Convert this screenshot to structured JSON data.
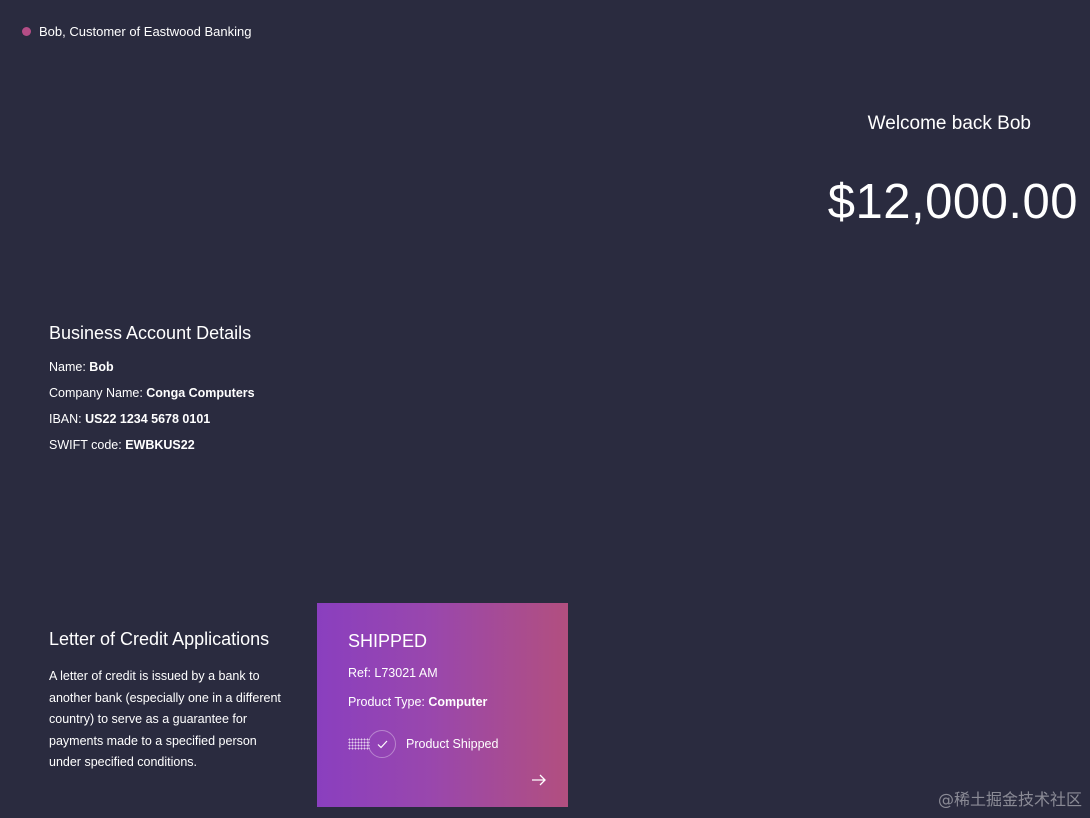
{
  "header": {
    "user_label": "Bob, Customer of Eastwood Banking"
  },
  "summary": {
    "welcome": "Welcome back Bob",
    "balance": "$12,000.00"
  },
  "account": {
    "title": "Business Account Details",
    "name_label": "Name: ",
    "name_value": "Bob",
    "company_label": "Company Name: ",
    "company_value": "Conga Computers",
    "iban_label": "IBAN: ",
    "iban_value": "US22 1234 5678 0101",
    "swift_label": "SWIFT code: ",
    "swift_value": "EWBKUS22"
  },
  "letter_of_credit": {
    "title": "Letter of Credit Applications",
    "description": "A letter of credit is issued by a bank to another bank (especially one in a different country) to serve as a guarantee for payments made to a specified person under specified conditions."
  },
  "card": {
    "status": "SHIPPED",
    "ref_label": "Ref: ",
    "ref_value": "L73021 AM",
    "product_type_label": "Product Type: ",
    "product_type_value": "Computer",
    "progress_label": "Product Shipped",
    "progress_icon": "check-icon",
    "arrow_icon": "arrow-right-icon"
  },
  "watermark": "@稀土掘金技术社区",
  "colors": {
    "background": "#2a2b3f",
    "user_dot": "#b44d86",
    "card_gradient_start": "#8a3fbf",
    "card_gradient_end": "#b24f7f"
  }
}
